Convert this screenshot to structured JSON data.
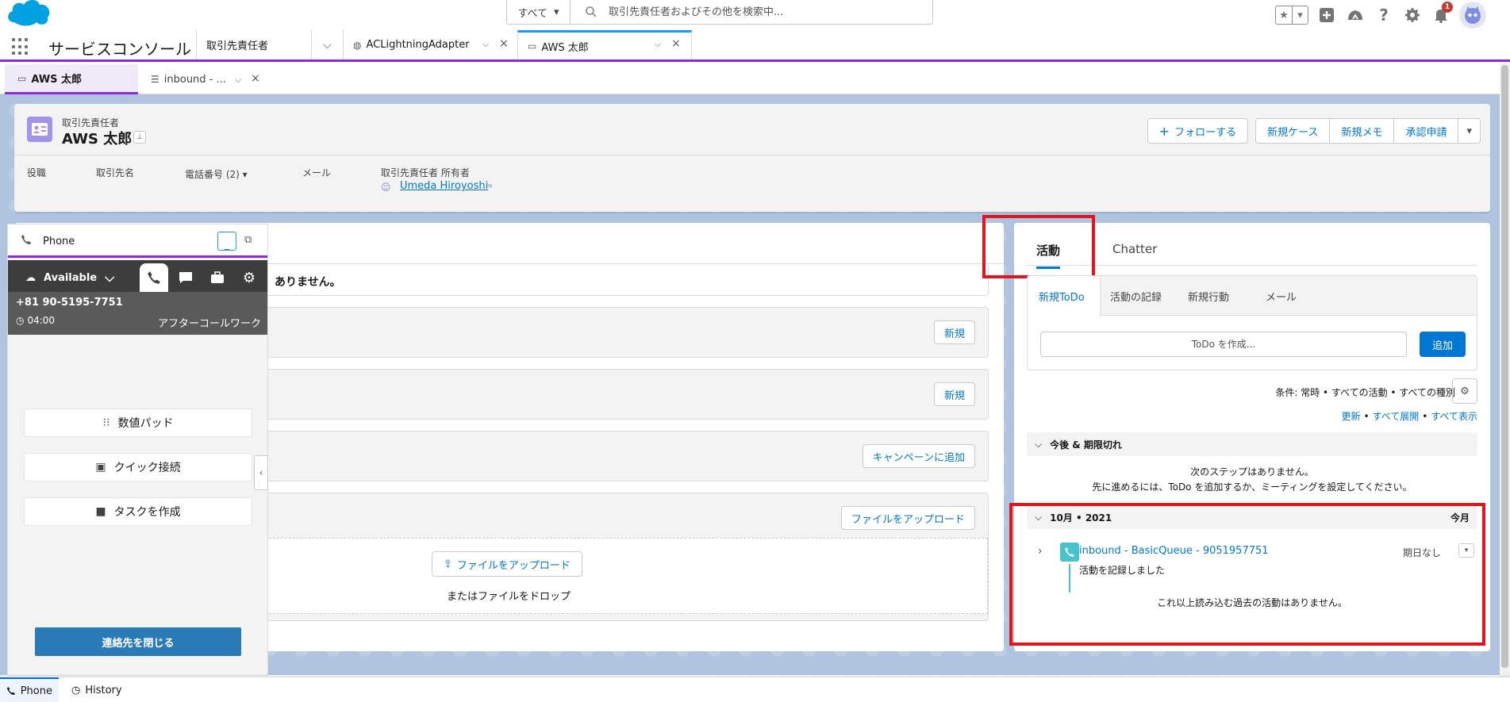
{
  "header": {
    "search_scope": "すべて",
    "search_placeholder": "取引先責任者およびその他を検索中...",
    "notification_count": "1"
  },
  "nav": {
    "app_name": "サービスコンソール",
    "tabs": [
      {
        "label": "取引先責任者"
      },
      {
        "label": "ACLightningAdapter"
      },
      {
        "label": "AWS 太郎"
      }
    ]
  },
  "subtabs": [
    {
      "label": "AWS 太郎"
    },
    {
      "label": "inbound - ..."
    }
  ],
  "record": {
    "type": "取引先責任者",
    "name": "AWS 太郎",
    "actions": {
      "follow": "フォローする",
      "new_case": "新規ケース",
      "new_memo": "新規メモ",
      "approval": "承認申請"
    },
    "fields": {
      "title": "役職",
      "account": "取引先名",
      "phone": "電話番号 (2)",
      "email": "メール",
      "owner_label": "取引先責任者 所有者",
      "owner_name": "Umeda Hiroyoshi"
    }
  },
  "center": {
    "no_items_text": "ありません。",
    "new_label_1": "新規",
    "new_label_2": "新規",
    "campaign_label": "キャンペーンに追加",
    "upload_label": "ファイルをアップロード",
    "upload_button_label": "ファイルをアップロード",
    "drop_text": "またはファイルをドロップ"
  },
  "activity": {
    "tab_activity": "活動",
    "tab_chatter": "Chatter",
    "composer_tabs": [
      "新規ToDo",
      "活動の記録",
      "新規行動",
      "メール"
    ],
    "todo_placeholder": "ToDo を作成...",
    "add_label": "追加",
    "filter_text": "条件: 常時 • すべての活動 • すべての種別",
    "links": {
      "refresh": "更新",
      "expand_all": "すべて展開",
      "show_all": "すべて表示"
    },
    "upcoming_header": "今後 & 期限切れ",
    "no_next_steps": "次のステップはありません。",
    "next_steps_hint": "先に進めるには、ToDo を追加するか、ミーティングを設定してください。",
    "month_header": "10月 • 2021",
    "month_label": "今月",
    "item_title": "inbound - BasicQueue - 9051957751",
    "item_sub": "活動を記録しました",
    "item_date": "期日なし",
    "no_more": "これ以上読み込む過去の活動はありません。"
  },
  "softphone": {
    "title": "Phone",
    "status": "Available",
    "number": "+81 90-5195-7751",
    "timer": "04:00",
    "state": "アフターコールワーク",
    "dialpad": "数値パッド",
    "quick_connect": "クイック接続",
    "create_task": "タスクを作成",
    "close_contact": "連絡先を閉じる"
  },
  "utility": {
    "phone": "Phone",
    "history": "History"
  },
  "colors": {
    "brand_blue": "#0176d3",
    "console_purple": "#8a2be2",
    "highlight_red": "#e0161d",
    "softphone_dark": "#3d3d3d"
  }
}
